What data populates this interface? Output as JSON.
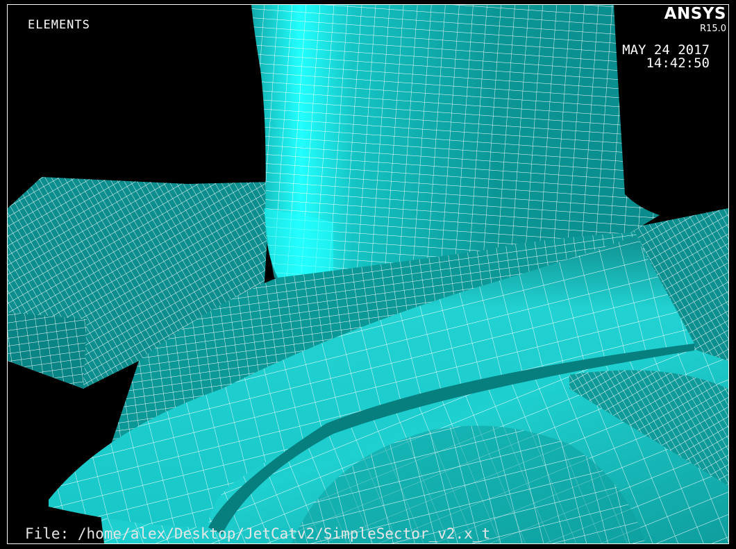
{
  "window": {
    "plot_title": "ELEMENTS",
    "brand": "ANSYS",
    "version": "R15.0",
    "date": "MAY 24 2017",
    "time": "14:42:50",
    "file": "File: /home/alex/Desktop/JetCatv2/SimpleSector_v2.x_t"
  },
  "colors": {
    "background": "#000000",
    "mesh_dark": "#0a8f8f",
    "mesh_mid": "#14b4b4",
    "mesh_light": "#2ad6d6",
    "mesh_bright": "#22ffff",
    "grid_lines": "#ffffff",
    "text": "#ffffff"
  }
}
